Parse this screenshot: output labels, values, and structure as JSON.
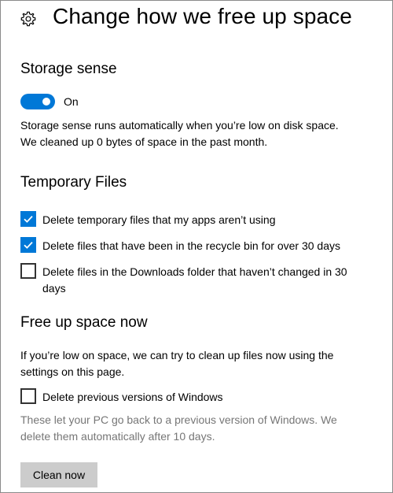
{
  "header": {
    "icon": "gear-icon",
    "title": "Change how we free up space"
  },
  "storage_sense": {
    "title": "Storage sense",
    "toggle_state": "on",
    "toggle_label": "On",
    "description_line1": "Storage sense runs automatically when you’re low on disk space.",
    "description_line2": "We cleaned up 0 bytes of space in the past month."
  },
  "temporary_files": {
    "title": "Temporary Files",
    "options": [
      {
        "label": "Delete temporary files that my apps aren’t using",
        "checked": true
      },
      {
        "label": "Delete files that have been in the recycle bin for over 30 days",
        "checked": true
      },
      {
        "label": "Delete files in the Downloads folder that haven’t changed in 30 days",
        "checked": false
      }
    ]
  },
  "free_up_now": {
    "title": "Free up space now",
    "description": "If you’re low on space, we can try to clean up files now using the settings on this page.",
    "option_label": "Delete previous versions of Windows",
    "option_checked": false,
    "note": "These let your PC go back to a previous version of Windows. We delete them automatically after 10 days.",
    "button_label": "Clean now"
  },
  "colors": {
    "accent": "#0078d7",
    "button_bg": "#cccccc",
    "muted_text": "#767676"
  }
}
